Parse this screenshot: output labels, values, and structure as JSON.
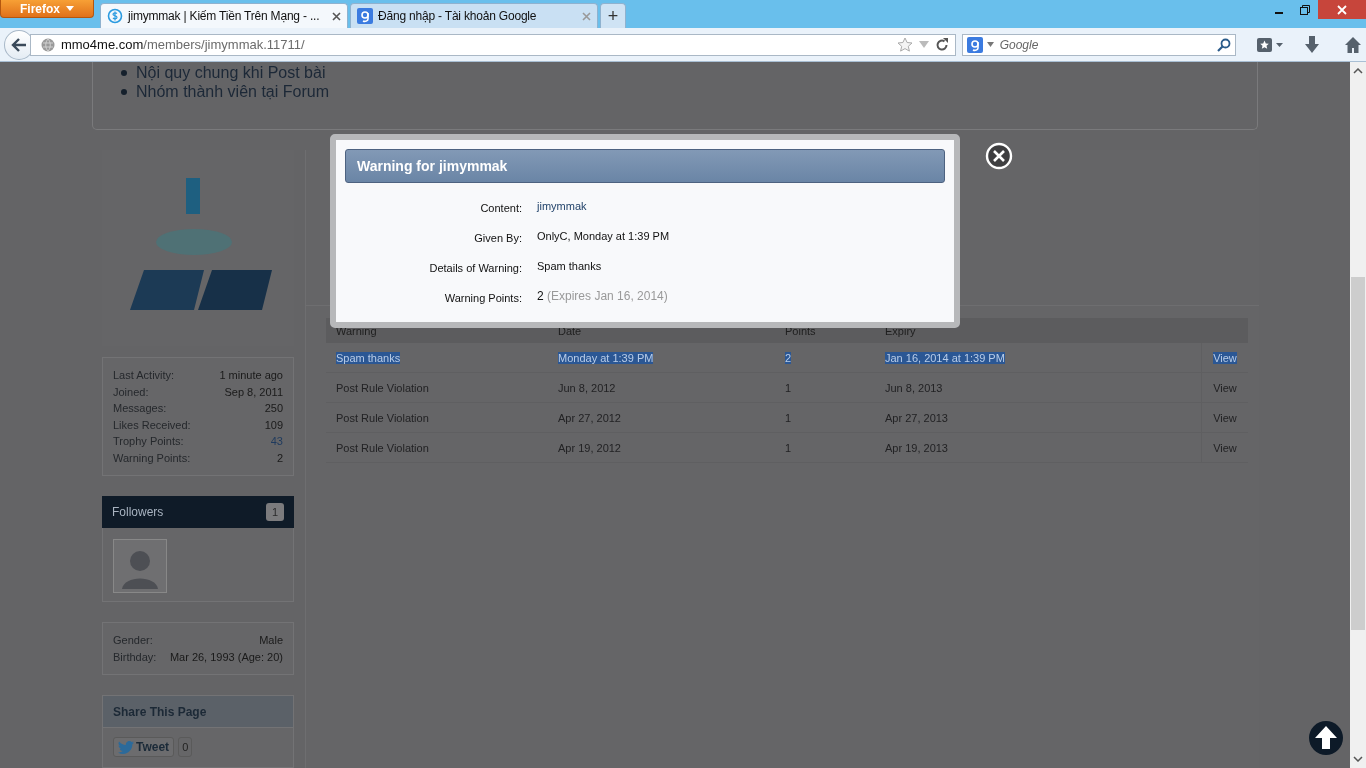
{
  "browser": {
    "menu_button": "Firefox",
    "tabs": [
      {
        "title": "jimymmak | Kiếm Tiền Trên Mạng - ...",
        "selected": true,
        "kind": "site"
      },
      {
        "title": "Đăng nhập - Tài khoản Google",
        "selected": false,
        "kind": "search"
      }
    ],
    "new_tab": "+",
    "url": {
      "domain": "mmo4me.com",
      "path": "/members/jimymmak.11711/"
    },
    "search": {
      "placeholder": "Google"
    }
  },
  "rules_list": [
    "Nội quy chung khi Post bài",
    "Nhóm thành viên tại Forum"
  ],
  "stats": [
    {
      "label": "Last Activity:",
      "value": "1 minute ago",
      "link": false
    },
    {
      "label": "Joined:",
      "value": "Sep 8, 2011",
      "link": false
    },
    {
      "label": "Messages:",
      "value": "250",
      "link": false
    },
    {
      "label": "Likes Received:",
      "value": "109",
      "link": false
    },
    {
      "label": "Trophy Points:",
      "value": "43",
      "link": true
    },
    {
      "label": "Warning Points:",
      "value": "2",
      "link": false
    }
  ],
  "followers": {
    "title": "Followers",
    "count": "1"
  },
  "personal": [
    {
      "label": "Gender:",
      "value": "Male"
    },
    {
      "label": "Birthday:",
      "value": "Mar 26, 1993 (Age: 20)"
    }
  ],
  "share": {
    "title": "Share This Page",
    "tweet": "Tweet",
    "tweet_count": "0"
  },
  "warnings_table": {
    "columns": [
      "Warning",
      "Date",
      "Points",
      "Expiry"
    ],
    "rows": [
      {
        "warning": "Spam thanks",
        "date": "Monday at 1:39 PM",
        "points": "2",
        "expiry": "Jan 16, 2014 at 1:39 PM",
        "action": "View",
        "selected": true
      },
      {
        "warning": "Post Rule Violation",
        "date": "Jun 8, 2012",
        "points": "1",
        "expiry": "Jun 8, 2013",
        "action": "View",
        "selected": false
      },
      {
        "warning": "Post Rule Violation",
        "date": "Apr 27, 2012",
        "points": "1",
        "expiry": "Apr 27, 2013",
        "action": "View",
        "selected": false
      },
      {
        "warning": "Post Rule Violation",
        "date": "Apr 19, 2012",
        "points": "1",
        "expiry": "Apr 19, 2013",
        "action": "View",
        "selected": false
      }
    ]
  },
  "modal": {
    "title": "Warning for jimymmak",
    "fields": [
      {
        "label": "Content:",
        "value": "jimymmak",
        "kind": "link"
      },
      {
        "label": "Given By:",
        "value": "OnlyC, Monday at 1:39 PM",
        "kind": "text"
      },
      {
        "label": "Details of Warning:",
        "value": "Spam thanks",
        "kind": "text"
      },
      {
        "label": "Warning Points:",
        "value": "2",
        "note": "(Expires Jan 16, 2014)",
        "kind": "text"
      }
    ]
  }
}
